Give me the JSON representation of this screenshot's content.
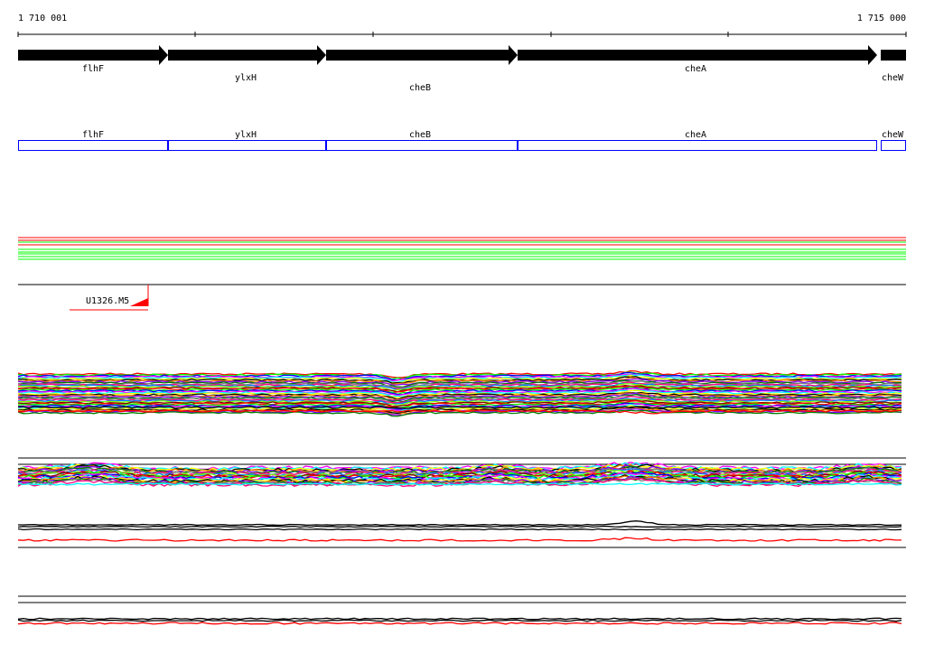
{
  "ruler": {
    "start_label": "1 710 001",
    "end_label": "1 715 000"
  },
  "genes": [
    {
      "name": "flhF"
    },
    {
      "name": "ylxH"
    },
    {
      "name": "cheB"
    },
    {
      "name": "cheA"
    },
    {
      "name": "cheW"
    }
  ],
  "track_label": "U1326.M5",
  "colors": {
    "gene_fill": "#000000",
    "box_stroke": "#0000ff",
    "red": "#ff0000",
    "green": "#00ff00",
    "palette": [
      "#ff0000",
      "#00ff00",
      "#0000ff",
      "#ff00ff",
      "#00ffff",
      "#ffff00",
      "#000000",
      "#ff8000",
      "#8000ff",
      "#008000",
      "#808080",
      "#ff0080",
      "#0080ff",
      "#80ff00",
      "#800000"
    ]
  }
}
